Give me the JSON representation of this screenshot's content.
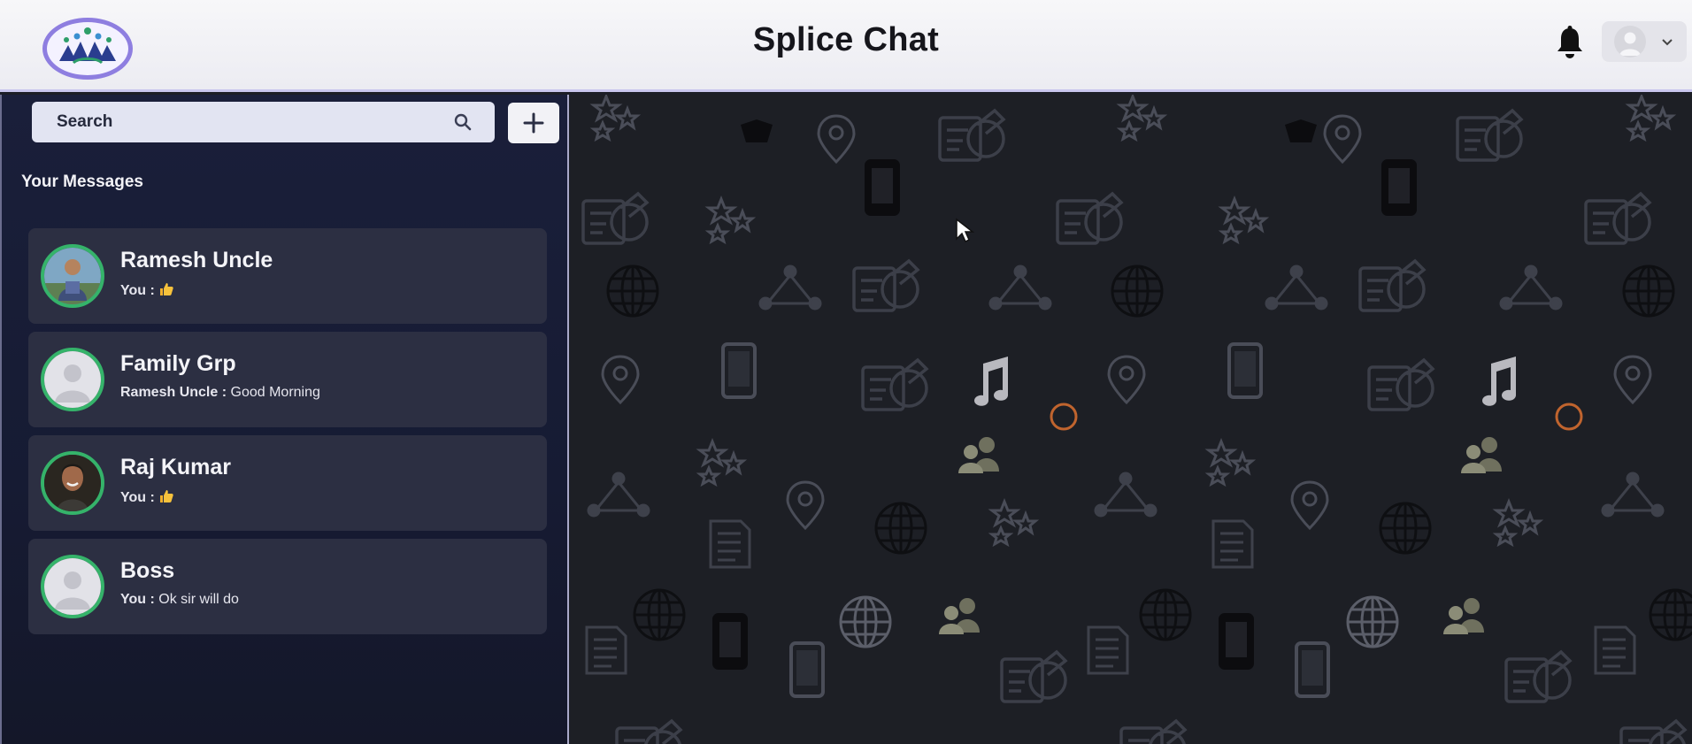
{
  "header": {
    "title": "Splice Chat",
    "logo_icon": "people-logo-icon",
    "notification_icon": "bell-icon",
    "profile_icon": "user-avatar-icon",
    "profile_menu_icon": "chevron-down-icon"
  },
  "sidebar": {
    "search": {
      "placeholder": "Search",
      "value": ""
    },
    "add_button_icon": "plus-icon",
    "section_title": "Your Messages",
    "chats": [
      {
        "name": "Ramesh Uncle",
        "sender": "You :",
        "message": "",
        "message_icon": "thumbs-up-emoji",
        "avatar": "photo"
      },
      {
        "name": "Family Grp",
        "sender": "Ramesh Uncle :",
        "message": "Good Morning",
        "avatar": "default"
      },
      {
        "name": "Raj Kumar",
        "sender": "You :",
        "message": "",
        "message_icon": "thumbs-up-emoji",
        "avatar": "photo"
      },
      {
        "name": "Boss",
        "sender": "You :",
        "message": "Ok sir will do",
        "avatar": "default"
      }
    ]
  },
  "colors": {
    "header_bg": "#f2f2f6",
    "sidebar_bg": "#181c35",
    "chat_item_bg": "#2c2f42",
    "avatar_ring": "#35b36a",
    "chat_bg": "#1d1f25",
    "logo_ring": "#8e7ee0"
  }
}
